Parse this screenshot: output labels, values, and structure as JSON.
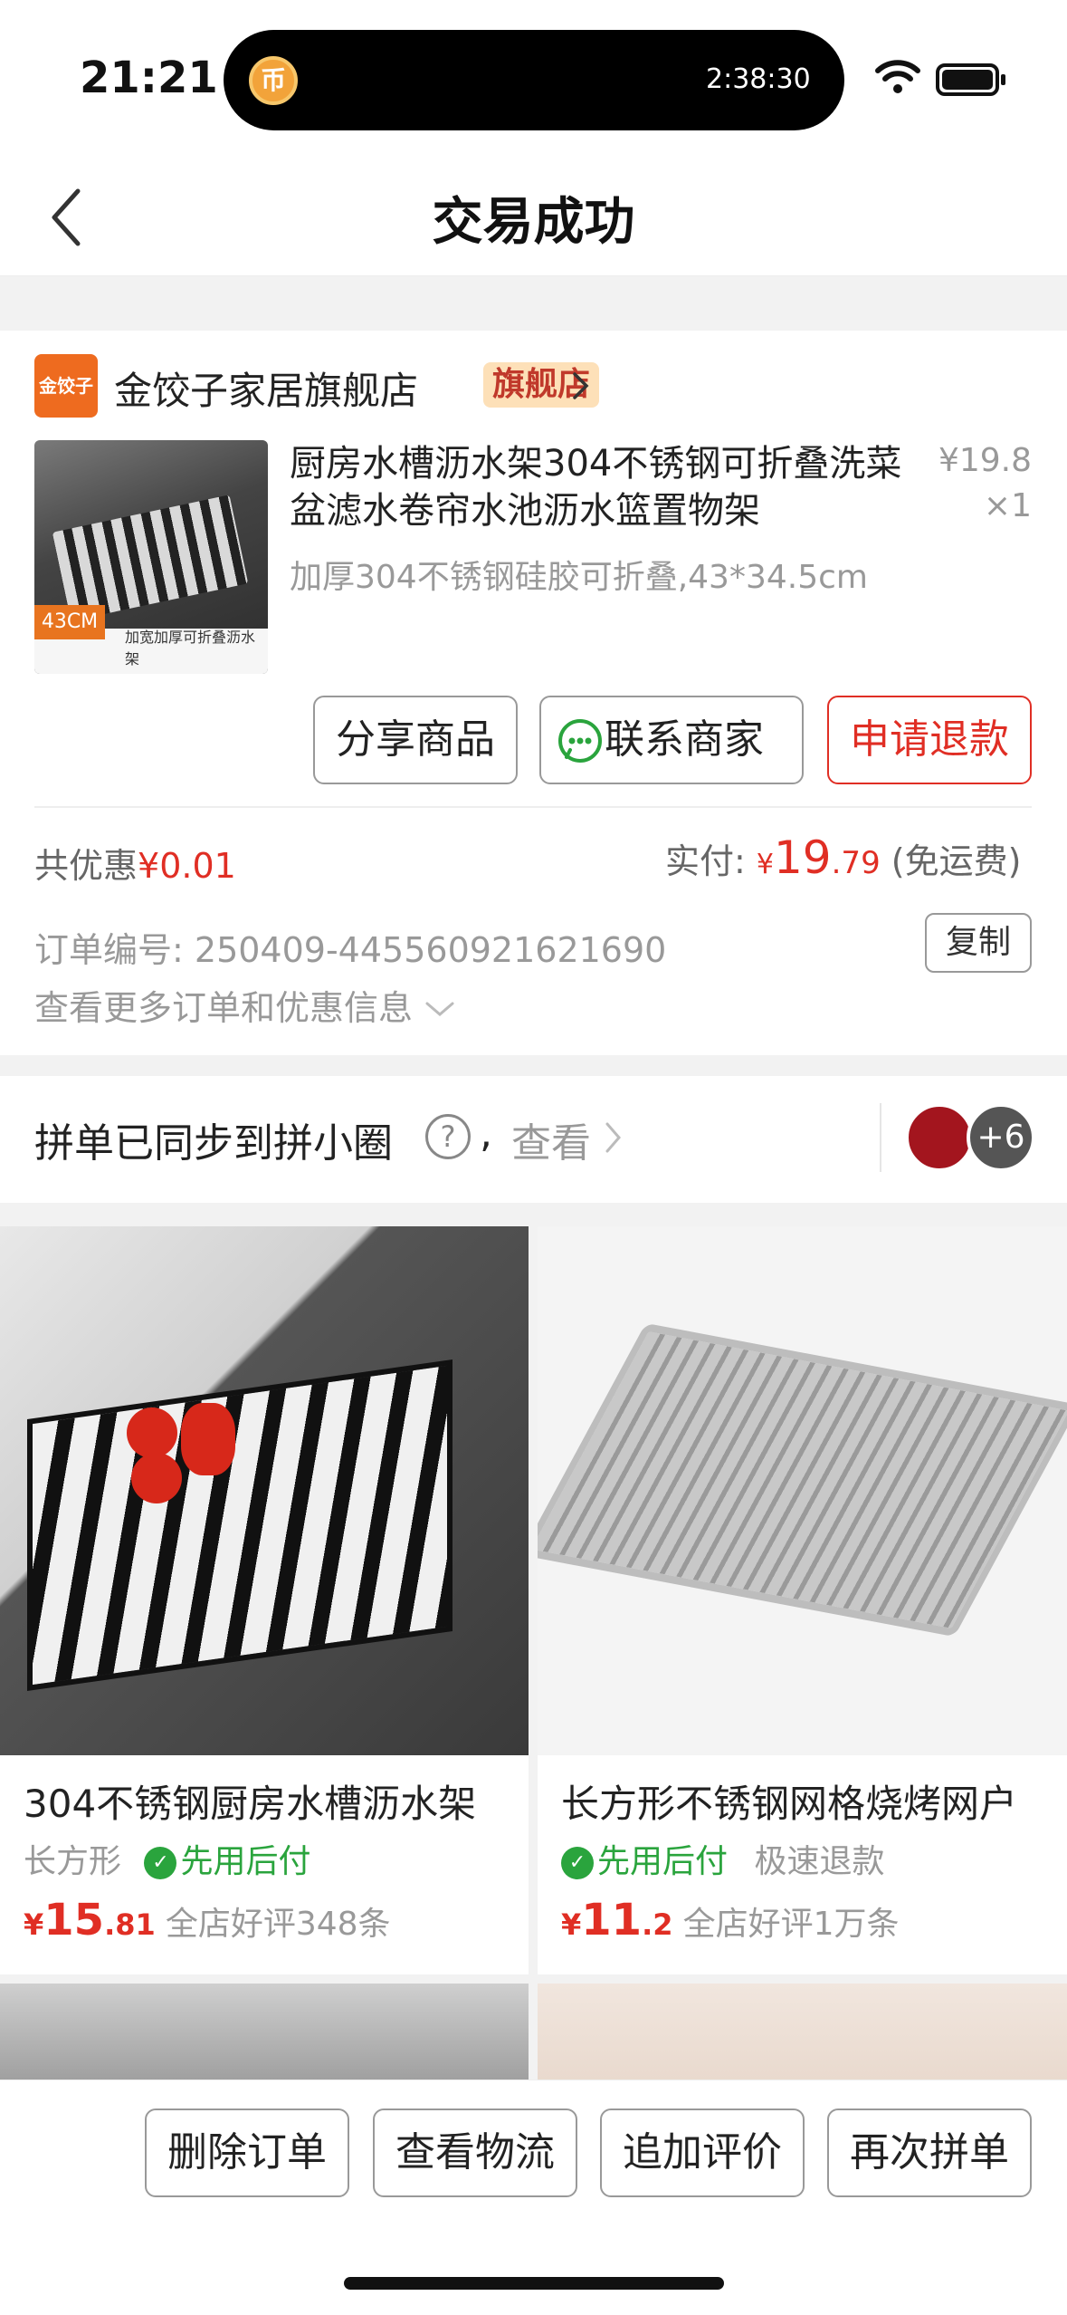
{
  "status_bar": {
    "time": "21:21",
    "island_time": "2:38:30",
    "coin_glyph": "币"
  },
  "nav": {
    "title": "交易成功"
  },
  "shop": {
    "logo_text": "金饺子",
    "name": "金饺子家居旗舰店",
    "tag": "旗舰店"
  },
  "product": {
    "title": "厨房水槽沥水架304不锈钢可折叠洗菜盆滤水卷帘水池沥水篮置物架",
    "spec": "加厚304不锈钢硅胶可折叠,43*34.5cm",
    "price": "¥19.8",
    "qty": "×1",
    "image_badge": "43CM",
    "image_caption": "加宽加厚可折叠沥水架"
  },
  "actions": {
    "share": "分享商品",
    "contact": "联系商家",
    "refund": "申请退款"
  },
  "summary": {
    "discount_label": "共优惠",
    "discount_value": "¥0.01",
    "paid_label": "实付:",
    "paid_currency": "¥",
    "paid_int": "19",
    "paid_dec": ".79",
    "shipping": "(免运费)"
  },
  "order": {
    "number_label": "订单编号:",
    "number": "250409-445560921621690",
    "copy": "复制",
    "more": "查看更多订单和优惠信息"
  },
  "social": {
    "text": "拼单已同步到拼小圈",
    "help": "?",
    "comma": ",",
    "view": "查看",
    "more_count": "+6"
  },
  "recommendations": [
    {
      "title": "304不锈钢厨房水槽沥水架",
      "tag1": "长方形",
      "tag2": "先用后付",
      "currency": "¥",
      "price_int": "15",
      "price_dec": ".81",
      "reviews": "全店好评348条"
    },
    {
      "title": "长方形不锈钢网格烧烤网户",
      "tag1": "先用后付",
      "tag2": "极速退款",
      "currency": "¥",
      "price_int": "11",
      "price_dec": ".2",
      "reviews": "全店好评1万条"
    }
  ],
  "bottom_bar": {
    "delete": "删除订单",
    "logistics": "查看物流",
    "review": "追加评价",
    "reorder": "再次拼单"
  },
  "colors": {
    "accent_red": "#e02e24",
    "green": "#2aa43d",
    "shop_orange": "#ee6b1f"
  }
}
